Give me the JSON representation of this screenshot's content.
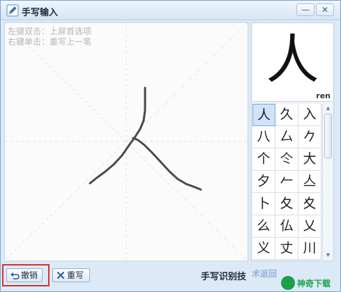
{
  "window": {
    "title": "手写输入",
    "minimize_label": "—",
    "close_label": "✕"
  },
  "canvas": {
    "hint_double_click": "左键双击：上屏首选项",
    "hint_right_click": "右键单击：重写上一笔"
  },
  "preview": {
    "character": "人",
    "pinyin": "ren"
  },
  "candidates": [
    "人",
    "久",
    "入",
    "八",
    "厶",
    "𠂊",
    "个",
    "仒",
    "大",
    "夕",
    "𠂉",
    "亼",
    "卜",
    "夂",
    "夊",
    "么",
    "仏",
    "乂",
    "义",
    "丈",
    "川"
  ],
  "scroll": {
    "up": "▲",
    "down": "▼"
  },
  "buttons": {
    "undo_label": "撤销",
    "rewrite_label": "重写"
  },
  "footer": {
    "title": "手写识别技",
    "overlay": "术返回",
    "watermark": "神奇下载"
  },
  "colors": {
    "highlight": "#d9312b",
    "accent": "#7fa2c8",
    "stroke": "#4a4a4a"
  }
}
